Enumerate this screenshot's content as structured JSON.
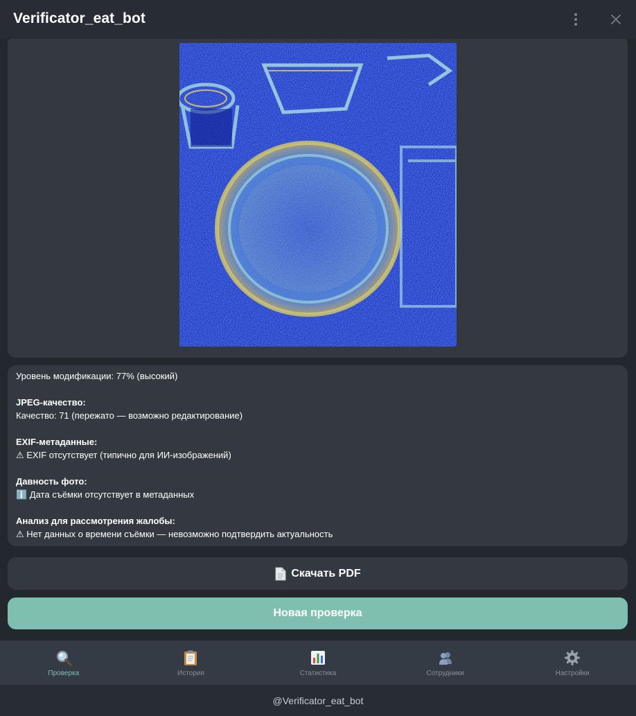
{
  "window": {
    "title": "Verificator_eat_bot"
  },
  "report": {
    "modification_level": "Уровень модификации: 77% (высокий)",
    "jpeg_heading": "JPEG-качество:",
    "jpeg_value": "Качество: 71 (пережато — возможно редактирование)",
    "exif_heading": "EXIF-метаданные:",
    "exif_value": "⚠ EXIF отсутствует (типично для ИИ-изображений)",
    "age_heading": "Давность фото:",
    "age_value": "ℹ️ Дата съёмки отсутствует в метаданных",
    "complaint_heading": "Анализ для рассмотрения жалобы:",
    "complaint_value": "⚠ Нет данных о времени съёмки — невозможно подтвердить актуальность"
  },
  "buttons": {
    "download_pdf": "Скачать PDF",
    "new_check": "Новая проверка"
  },
  "nav": {
    "items": [
      {
        "label": "Проверка",
        "icon": "magnifier-icon",
        "active": true
      },
      {
        "label": "История",
        "icon": "clipboard-icon",
        "active": false
      },
      {
        "label": "Статистика",
        "icon": "bar-chart-icon",
        "active": false
      },
      {
        "label": "Сотрудники",
        "icon": "people-icon",
        "active": false
      },
      {
        "label": "Настройки",
        "icon": "gear-icon",
        "active": false
      }
    ]
  },
  "footer": {
    "bot_handle": "@Verificator_eat_bot"
  },
  "colors": {
    "accent": "#7fbfb0",
    "card": "#343941",
    "background": "#23282f"
  }
}
